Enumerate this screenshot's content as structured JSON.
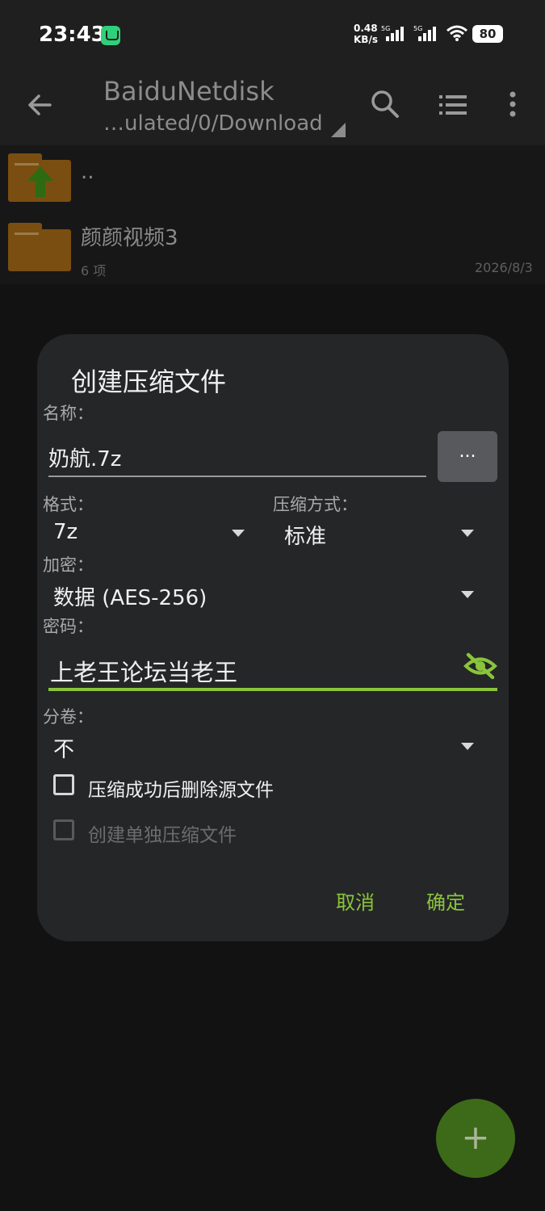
{
  "status_bar": {
    "time": "23:43",
    "net_speed_value": "0.48",
    "net_speed_unit": "KB/s",
    "battery": "80",
    "sim1_label": "5G",
    "sim2_label": "5G"
  },
  "app_bar": {
    "title": "BaiduNetdisk",
    "path": "…ulated/0/Download"
  },
  "files": [
    {
      "name": "..",
      "meta": "",
      "date": "",
      "kind": "parent"
    },
    {
      "name": "颜颜视频3",
      "meta": "6 项",
      "date": "2026/8/3",
      "kind": "folder"
    }
  ],
  "dialog": {
    "title": "创建压缩文件",
    "name_label": "名称：",
    "name_value": "奶航.7z",
    "browse_label": "...",
    "format_label": "格式：",
    "format_value": "7z",
    "method_label": "压缩方式：",
    "method_value": "标准",
    "encryption_label": "加密：",
    "encryption_value": "数据 (AES-256)",
    "password_label": "密码：",
    "password_value": "上老王论坛当老王",
    "split_label": "分卷：",
    "split_value": "不",
    "delete_after_label": "压缩成功后删除源文件",
    "delete_after_checked": false,
    "separate_label": "创建单独压缩文件",
    "separate_checked": false,
    "separate_enabled": false,
    "cancel_label": "取消",
    "ok_label": "确定"
  },
  "fab_label": "+",
  "colors": {
    "accent": "#8ac43b",
    "dialog_bg": "#252628",
    "folder": "#7a4e10",
    "fab": "#3d6a18"
  }
}
